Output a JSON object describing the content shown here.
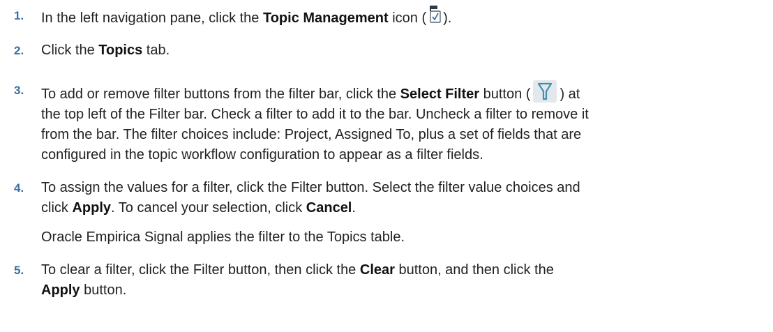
{
  "steps": [
    {
      "number": "1.",
      "text_before": "In the left navigation pane, click the ",
      "bold": "Topic Management",
      "text_after_1": " icon (",
      "icon": "topic-management-icon",
      "text_after_2": ")."
    },
    {
      "number": "2.",
      "text_before": "Click the ",
      "bold": "Topics",
      "text_after": " tab."
    },
    {
      "number": "3.",
      "l1_before": "To add or remove filter buttons from the filter bar, click the ",
      "l1_bold": "Select Filter",
      "l1_mid": " button (",
      "icon": "filter-funnel-icon",
      "l1_after": ") at",
      "l2": "the top left of the Filter bar. Check a filter to add it to the bar. Uncheck a filter to remove it",
      "l3": "from the bar. The filter choices include: Project, Assigned To, plus a set of fields that are",
      "l4": "configured in the topic workflow configuration to appear as a filter fields."
    },
    {
      "number": "4.",
      "l1": "To assign the values for a filter, click the Filter button. Select the filter value choices and",
      "l2_before": "click ",
      "l2_bold1": "Apply",
      "l2_mid": ". To cancel your selection, click ",
      "l2_bold2": "Cancel",
      "l2_after": ".",
      "note": "Oracle Empirica Signal applies the filter to the Topics table."
    },
    {
      "number": "5.",
      "l1_before": "To clear a filter, click the Filter button, then click the ",
      "l1_bold": "Clear",
      "l1_after": " button, and then click the",
      "l2_bold": "Apply",
      "l2_after": " button."
    }
  ],
  "colors": {
    "step_number": "#3b6ea5",
    "text": "#222222",
    "filter_icon_bg": "#e4e8ec",
    "filter_icon_stroke": "#3f8fb0"
  }
}
